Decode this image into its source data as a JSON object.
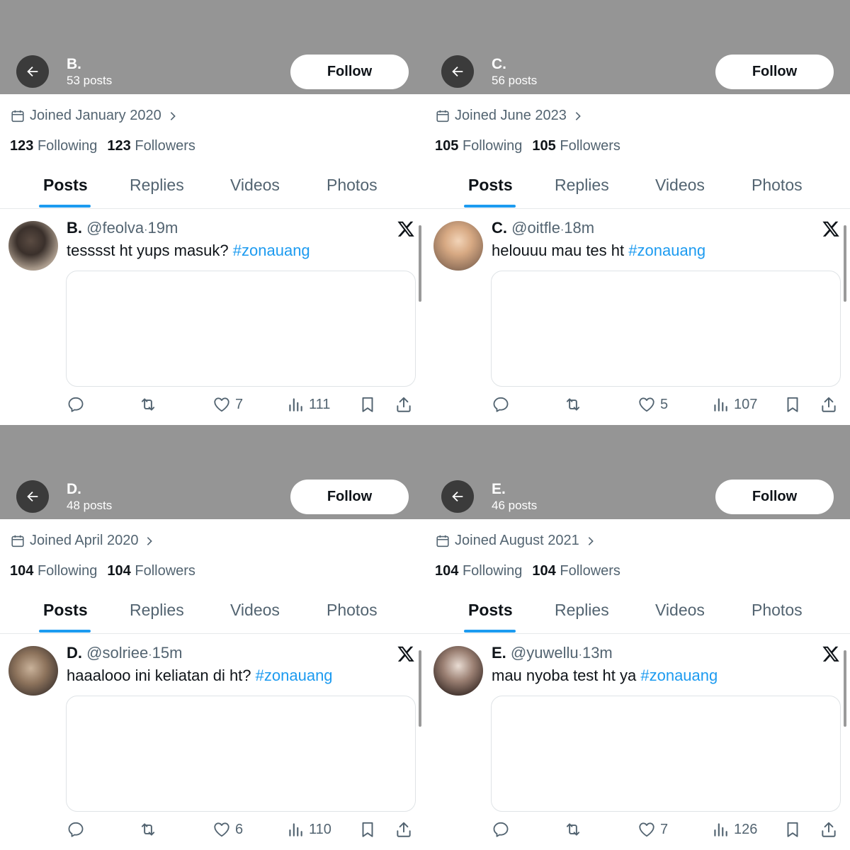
{
  "colors": {
    "header_bg": "#959595",
    "link_blue": "#1d9bf0",
    "muted_text": "#536471"
  },
  "icons": [
    "back-arrow-icon",
    "calendar-icon",
    "chevron-right-icon",
    "x-logo-icon",
    "reply-icon",
    "retweet-icon",
    "heart-icon",
    "views-icon",
    "bookmark-icon",
    "share-icon"
  ],
  "profiles": [
    {
      "header": {
        "name": "B.",
        "posts": "53 posts",
        "follow_label": "Follow"
      },
      "joined": "Joined January 2020",
      "following_count": "123",
      "following_label": "Following",
      "followers_count": "123",
      "followers_label": "Followers",
      "tabs": [
        "Posts",
        "Replies",
        "Videos",
        "Photos"
      ],
      "tweet": {
        "name": "B.",
        "handle": "@feolva",
        "sep": "·",
        "time": "19m",
        "text": "tesssst ht yups masuk?",
        "hashtag": "#zonauang",
        "likes": "7",
        "views": "111"
      }
    },
    {
      "header": {
        "name": "C.",
        "posts": "56 posts",
        "follow_label": "Follow"
      },
      "joined": "Joined June 2023",
      "following_count": "105",
      "following_label": "Following",
      "followers_count": "105",
      "followers_label": "Followers",
      "tabs": [
        "Posts",
        "Replies",
        "Videos",
        "Photos"
      ],
      "tweet": {
        "name": "C.",
        "handle": "@oitfle",
        "sep": "·",
        "time": "18m",
        "text": "helouuu mau tes ht",
        "hashtag": "#zonauang",
        "likes": "5",
        "views": "107"
      }
    },
    {
      "header": {
        "name": "D.",
        "posts": "48 posts",
        "follow_label": "Follow"
      },
      "joined": "Joined April 2020",
      "following_count": "104",
      "following_label": "Following",
      "followers_count": "104",
      "followers_label": "Followers",
      "tabs": [
        "Posts",
        "Replies",
        "Videos",
        "Photos"
      ],
      "tweet": {
        "name": "D.",
        "handle": "@solriee",
        "sep": "·",
        "time": "15m",
        "text": "haaalooo ini keliatan di ht?",
        "hashtag": "#zonauang",
        "likes": "6",
        "views": "110"
      }
    },
    {
      "header": {
        "name": "E.",
        "posts": "46 posts",
        "follow_label": "Follow"
      },
      "joined": "Joined August 2021",
      "following_count": "104",
      "following_label": "Following",
      "followers_count": "104",
      "followers_label": "Followers",
      "tabs": [
        "Posts",
        "Replies",
        "Videos",
        "Photos"
      ],
      "tweet": {
        "name": "E.",
        "handle": "@yuwellu",
        "sep": "·",
        "time": "13m",
        "text": "mau nyoba test ht ya",
        "hashtag": "#zonauang",
        "likes": "7",
        "views": "126"
      }
    }
  ]
}
